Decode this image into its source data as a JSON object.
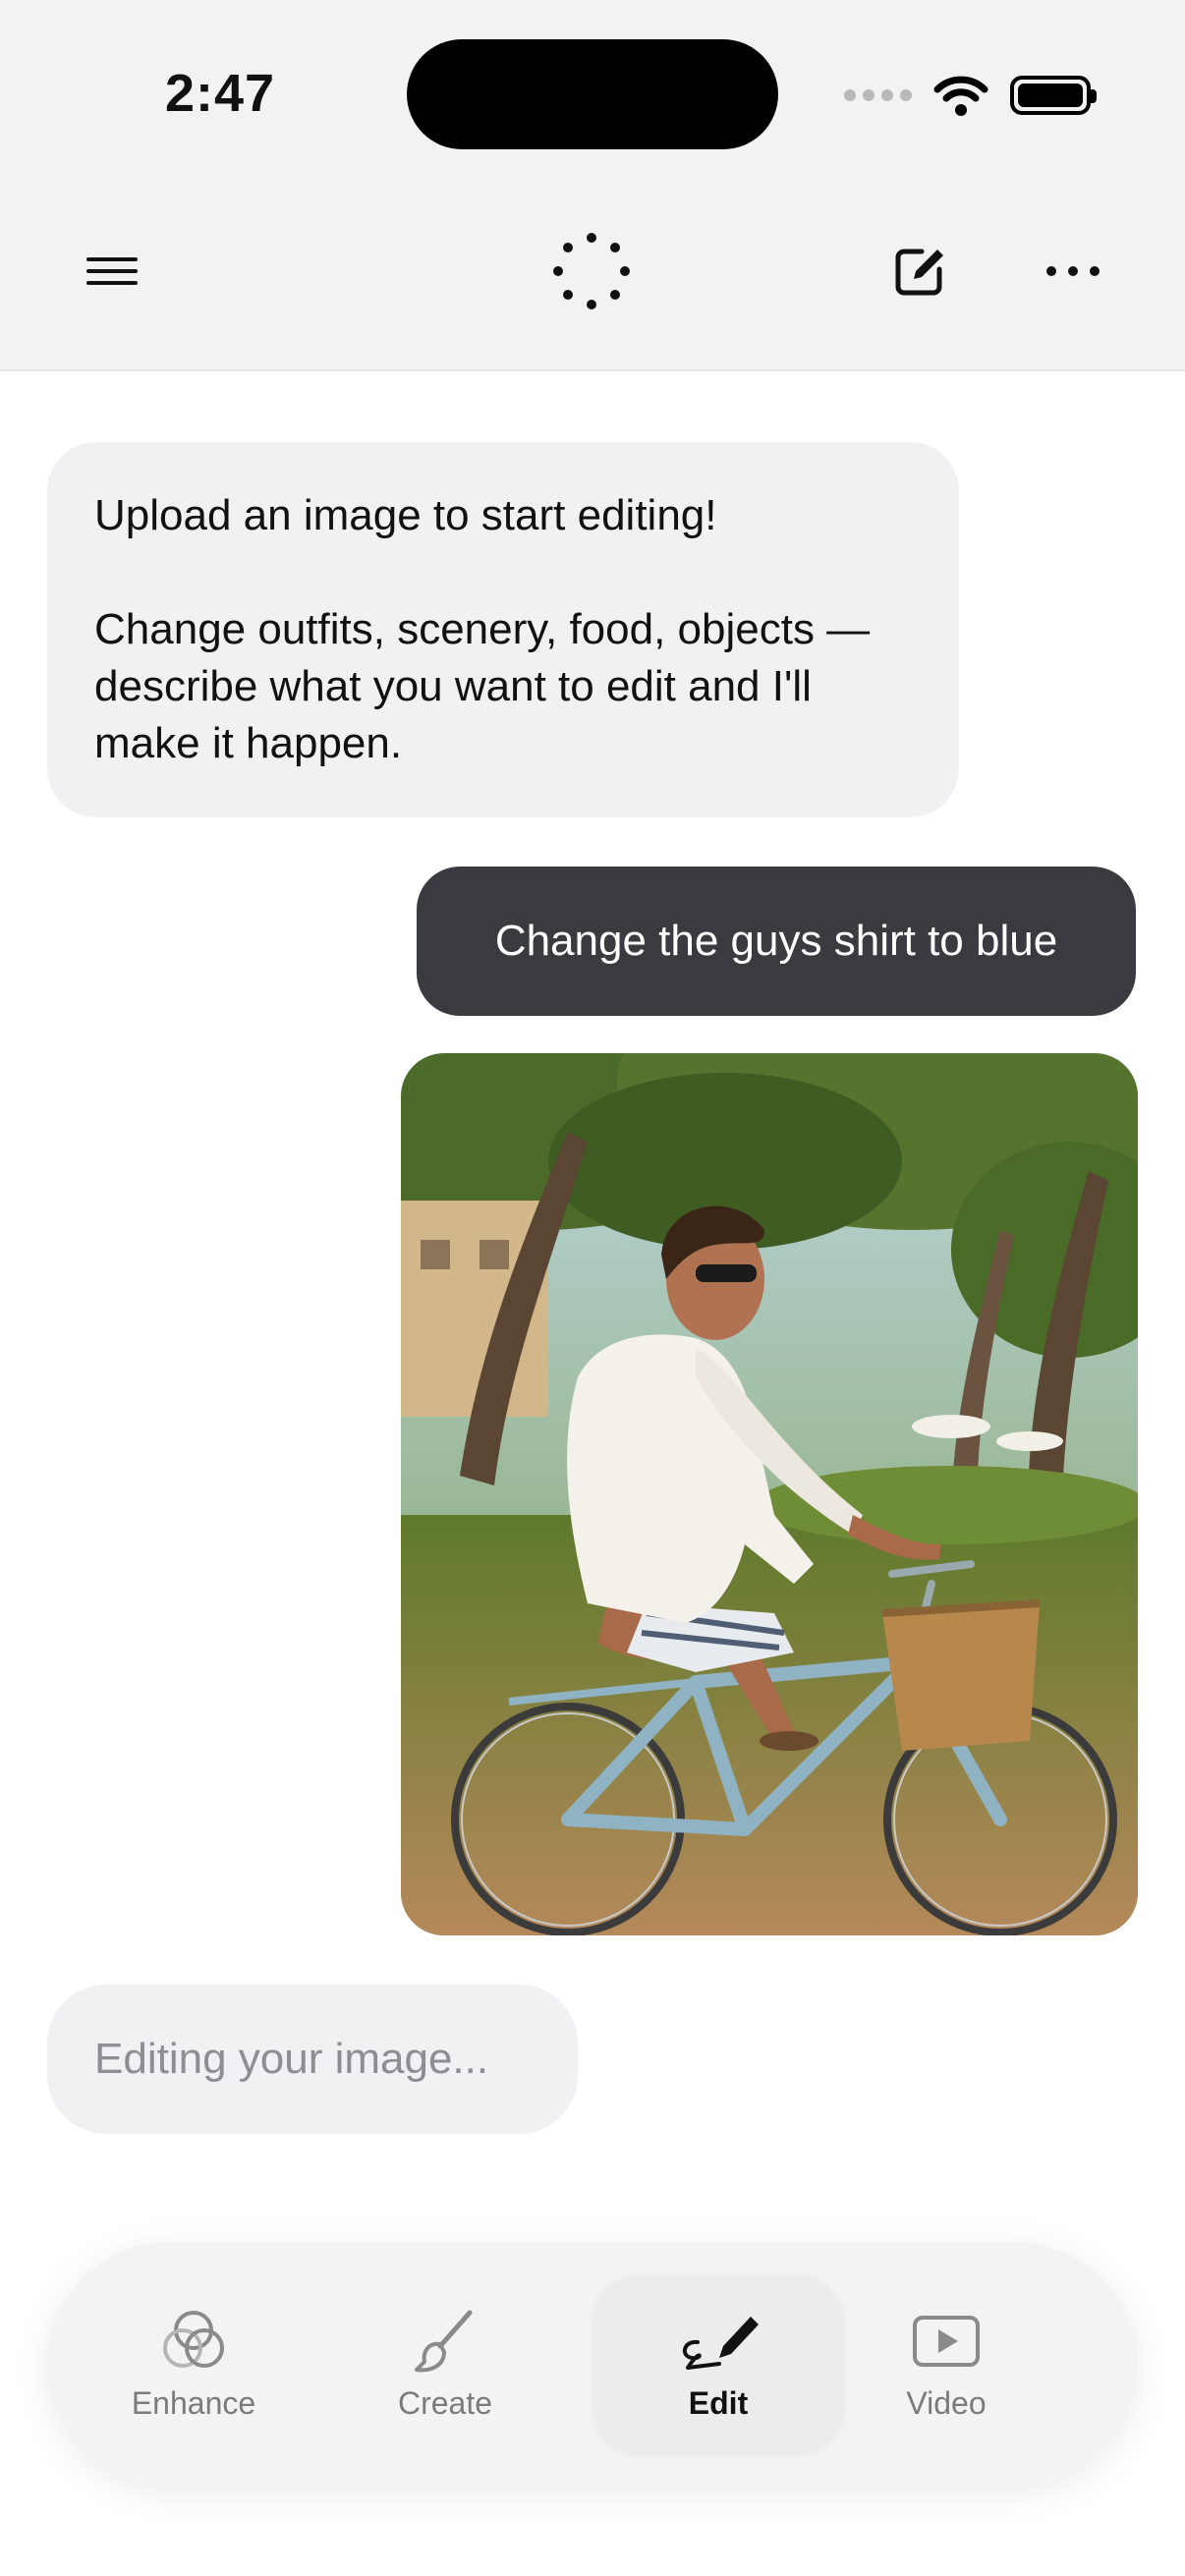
{
  "status_bar": {
    "time": "2:47"
  },
  "header": {
    "menu_icon": "hamburger-icon",
    "loading_icon": "dotted-spinner-icon",
    "compose_icon": "compose-icon",
    "more_icon": "ellipsis-icon"
  },
  "chat": {
    "bot_message": {
      "line1": "Upload an image to start editing!",
      "line2": "Change outfits, scenery, food, objects — describe what you want to edit and I'll make it happen."
    },
    "user_message": "Change the guys shirt to blue",
    "status_message": "Editing your image..."
  },
  "tabs": [
    {
      "label": "Enhance",
      "icon": "overlapping-circles-icon",
      "active": false
    },
    {
      "label": "Create",
      "icon": "paintbrush-icon",
      "active": false
    },
    {
      "label": "Edit",
      "icon": "pencil-scribble-icon",
      "active": true
    },
    {
      "label": "Video",
      "icon": "play-video-icon",
      "active": false
    }
  ],
  "colors": {
    "user_bubble": "#3a3b40",
    "bot_bubble": "#f1f1f4",
    "header_bg": "#f2f2f2"
  }
}
